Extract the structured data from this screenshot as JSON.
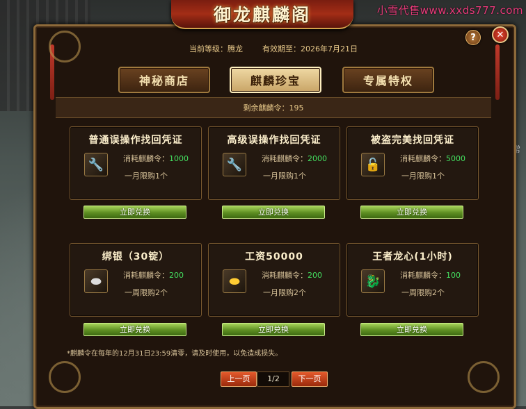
{
  "window": {
    "title": "御龙麒麟阁"
  },
  "watermark": "小雪代售www.xxds777.com",
  "side_glyph": "常",
  "info": {
    "level_label": "当前等级：腾龙",
    "valid_until": "有效期至：2026年7月21日"
  },
  "tabs": [
    {
      "label": "神秘商店",
      "active": false
    },
    {
      "label": "麒麟珍宝",
      "active": true
    },
    {
      "label": "专属特权",
      "active": false
    }
  ],
  "remaining": "剩余麒麟令：195",
  "cost_label": "消耗麒麟令：",
  "items": [
    {
      "title": "普通误操作找回凭证",
      "cost": "1000",
      "limit": "一月限购1个",
      "icon": "wrench-icon",
      "button": "立即兑换"
    },
    {
      "title": "高级误操作找回凭证",
      "cost": "2000",
      "limit": "一月限购1个",
      "icon": "wrench-icon",
      "button": "立即兑换"
    },
    {
      "title": "被盗完美找回凭证",
      "cost": "5000",
      "limit": "一月限购1个",
      "icon": "chest-icon",
      "button": "立即兑换"
    },
    {
      "title": "绑银（30锭）",
      "cost": "200",
      "limit": "一周限购2个",
      "icon": "silver-ingot-icon",
      "button": "立即兑换"
    },
    {
      "title": "工资50000",
      "cost": "200",
      "limit": "一月限购2个",
      "icon": "gold-ingot-icon",
      "button": "立即兑换"
    },
    {
      "title": "王者龙心(1小时)",
      "cost": "100",
      "limit": "一周限购2个",
      "icon": "dragon-heart-icon",
      "button": "立即兑换"
    }
  ],
  "notice": "*麒麟令在每年的12月31日23:59清零，请及时使用，以免造成损失。",
  "pager": {
    "prev": "上一页",
    "page": "1/2",
    "next": "下一页"
  },
  "buttons": {
    "help": "?",
    "close": "✕"
  },
  "colors": {
    "accent_gold": "#e8c98a",
    "cost_green": "#44e060",
    "button_green": "#5e8f22",
    "pager_red": "#c0401a"
  }
}
